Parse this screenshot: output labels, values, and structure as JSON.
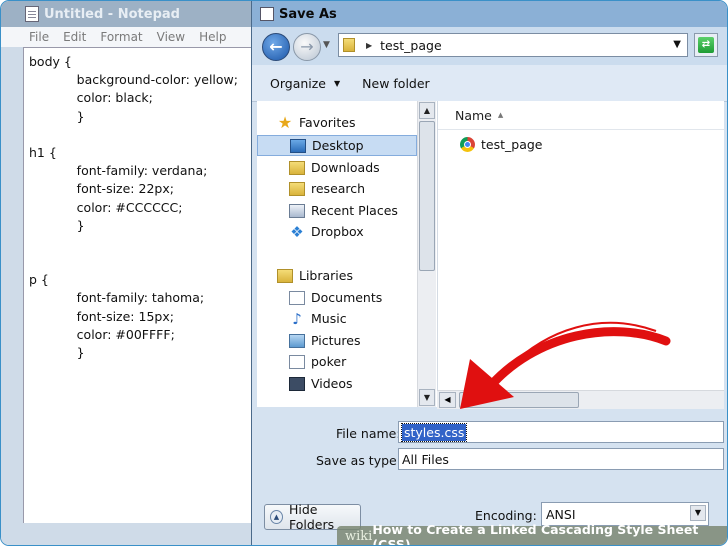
{
  "notepad": {
    "title": "Untitled - Notepad",
    "menu": [
      "File",
      "Edit",
      "Format",
      "View",
      "Help"
    ],
    "lines": [
      "body {",
      "            background-color: yellow;",
      "            color: black;",
      "            }",
      "",
      "h1 {",
      "            font-family: verdana;",
      "            font-size: 22px;",
      "            color: #CCCCCC;",
      "            }",
      "",
      "",
      "p {",
      "            font-family: tahoma;",
      "            font-size: 15px;",
      "            color: #00FFFF;",
      "            }"
    ]
  },
  "dialog": {
    "title": "Save As",
    "address": "test_page",
    "toolbar": {
      "organize": "Organize",
      "new_folder": "New folder"
    },
    "tree": [
      {
        "label": "Favorites",
        "icon": "star-icon"
      },
      {
        "label": "Desktop",
        "icon": "desktop-icon",
        "selected": true
      },
      {
        "label": "Downloads",
        "icon": "downloads-folder-icon"
      },
      {
        "label": "research",
        "icon": "folder-icon"
      },
      {
        "label": "Recent Places",
        "icon": "recent-places-icon"
      },
      {
        "label": "Dropbox",
        "icon": "dropbox-icon"
      },
      {
        "label": "Libraries",
        "icon": "libraries-icon"
      },
      {
        "label": "Documents",
        "icon": "documents-icon"
      },
      {
        "label": "Music",
        "icon": "music-icon"
      },
      {
        "label": "Pictures",
        "icon": "pictures-icon"
      },
      {
        "label": "poker",
        "icon": "poker-icon"
      },
      {
        "label": "Videos",
        "icon": "videos-icon"
      }
    ],
    "column_header": "Name",
    "files": [
      {
        "name": "test_page",
        "icon": "chrome-icon"
      }
    ],
    "file_name_label": "File name:",
    "file_name_value": "styles.css",
    "save_type_label": "Save as type:",
    "save_type_value": "All Files",
    "encoding_label": "Encoding:",
    "encoding_value": "ANSI",
    "hide_folders": "Hide Folders"
  },
  "banner": {
    "wiki": "wiki",
    "text": "How to Create a Linked Cascading Style Sheet (CSS)"
  },
  "colors": {
    "arrow": "#e01010",
    "selection": "#3163c8"
  }
}
